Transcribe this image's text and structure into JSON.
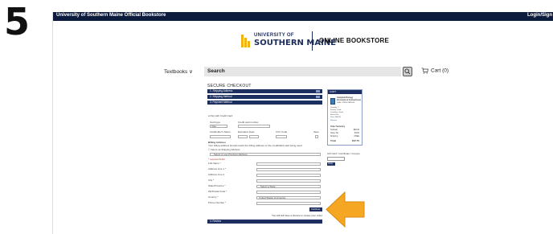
{
  "step": "5",
  "header": {
    "site": "University of Southern Maine Official Bookstore",
    "login": "Login/Sign"
  },
  "logo": {
    "line1": "UNIVERSITY OF",
    "line2": "SOUTHERN MAINE",
    "store": "ONLINE BOOKSTORE"
  },
  "nav": {
    "textbooks": "Textbooks ∨",
    "search_label": "Search",
    "cart_label": "Cart (0)"
  },
  "checkout": {
    "title": "SECURE CHECKOUT",
    "panels": [
      "1. Shipping Address",
      "2. Shipping Method",
      "3. Payment Method"
    ],
    "review_panel": "4. Review",
    "pay_with": "Pay with Credit Card",
    "card_type_label": "Card type",
    "card_type_value": "Visa",
    "card_number_label": "Credit card number",
    "name_label": "Cardholder's Name",
    "exp_label": "Expiration Date",
    "cvv_label": "CVV Code",
    "save_label": "Save",
    "billing_title": "Billing Address",
    "billing_note": "Your billing address should match the billing address on the credit/debit card being used.",
    "same_as_shipping": "Same as Shipping Address",
    "select_previous": "- Select or use Previous Address -",
    "required_note": "* required fields",
    "fields": [
      "Full Name *",
      "Address Line 1 *",
      "Address Line 2",
      "City *",
      "State/Province *",
      "Zip/Postal Code *",
      "Country *",
      "Phone Number *"
    ],
    "state_value": "- Select a State -",
    "country_value": "United States of America",
    "continue_label": "Continue",
    "final_note": "You will still have a chance to review your order."
  },
  "cart": {
    "header": "CART",
    "item_title": "Campbell Biology (Concepts & Connections)",
    "item_isbn": "ISBN: 9780321885555",
    "item_lines": [
      "Quantity: 1",
      "Format: Used",
      "Condition: Good",
      "Rental: No",
      "Price: $68.95"
    ],
    "remove": "Remove",
    "summary_title": "Order Summary",
    "subtotal_label": "Subtotal",
    "subtotal": "$68.95",
    "tax_label": "Sales Tax",
    "tax": "$3.80",
    "shipping_label": "Shipping",
    "shipping": "FREE",
    "total_label": "Total",
    "total": "$72.75"
  },
  "gift": {
    "label": "Gift Card / Certificate / Coupon",
    "apply": "Apply"
  },
  "colors": {
    "navy": "#0d1b3d",
    "panel": "#1d2f60",
    "gold": "#f2b213",
    "arrow": "#f5a623"
  }
}
